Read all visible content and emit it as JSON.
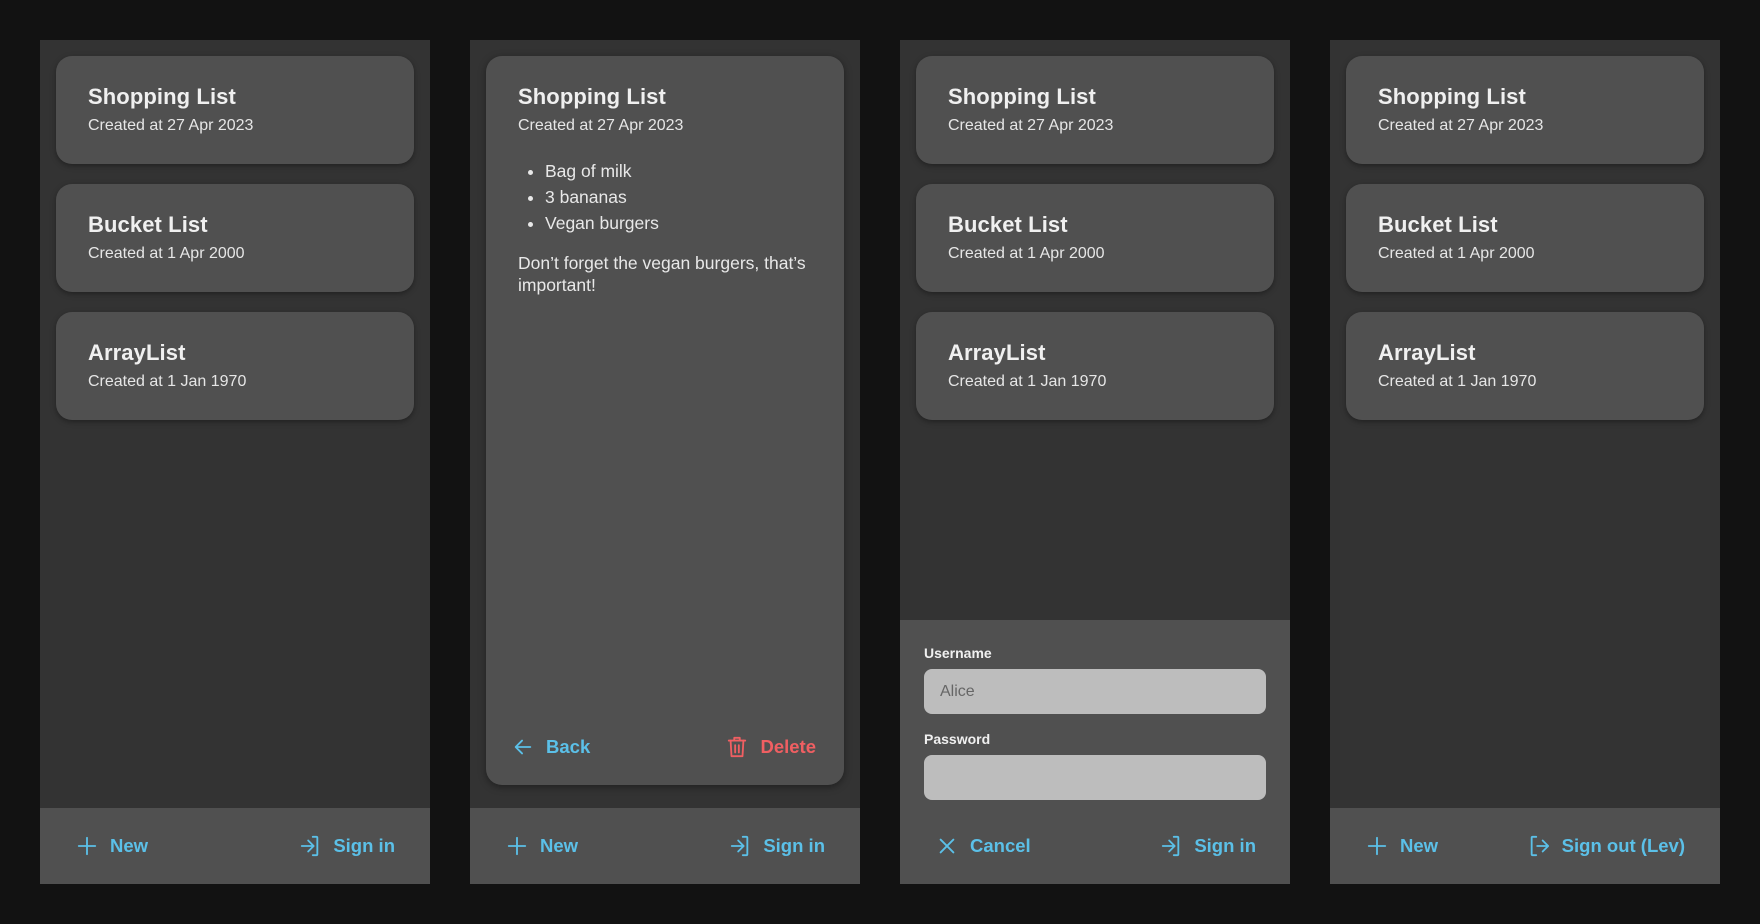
{
  "theme": {
    "accent": "#5bc0e8",
    "danger": "#f05f62",
    "background": "#121212",
    "panel": "#333333",
    "card": "#505050"
  },
  "lists": [
    {
      "title": "Shopping List",
      "created": "Created at 27 Apr 2023"
    },
    {
      "title": "Bucket List",
      "created": "Created at 1 Apr 2000"
    },
    {
      "title": "ArrayList",
      "created": "Created at 1 Jan 1970"
    }
  ],
  "detail": {
    "title": "Shopping List",
    "created": "Created at 27 Apr 2023",
    "items": [
      "Bag of milk",
      "3 bananas",
      "Vegan burgers"
    ],
    "note": "Don’t forget the vegan burgers, that’s important!",
    "back_label": "Back",
    "delete_label": "Delete"
  },
  "bottombar": {
    "new_label": "New",
    "sign_in_label": "Sign in",
    "sign_out_label": "Sign out (Lev)"
  },
  "login": {
    "username_label": "Username",
    "username_placeholder": "Alice",
    "username_value": "",
    "password_label": "Password",
    "password_value": "",
    "cancel_label": "Cancel",
    "sign_in_label": "Sign in"
  },
  "icons": {
    "new": "plus-icon",
    "sign_in": "sign-in-icon",
    "sign_out": "sign-out-icon",
    "back": "arrow-left-icon",
    "delete": "trash-icon",
    "cancel": "close-icon"
  }
}
